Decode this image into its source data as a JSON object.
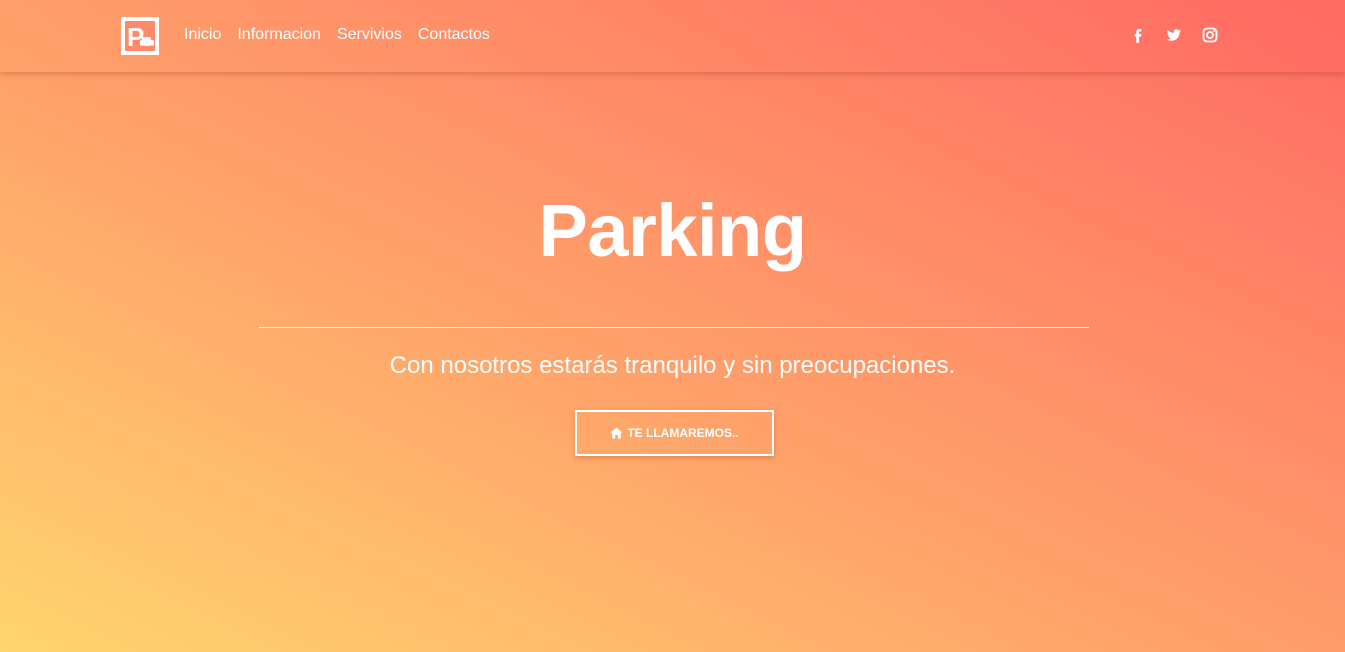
{
  "nav": {
    "logo_icon": "parking-car-icon",
    "links": [
      {
        "label": "Inicio"
      },
      {
        "label": "Informacion"
      },
      {
        "label": "Servivios"
      },
      {
        "label": "Contactos"
      }
    ],
    "social": [
      "facebook-icon",
      "twitter-icon",
      "instagram-icon"
    ]
  },
  "hero": {
    "title": "Parking",
    "subtitle": "Con nosotros estarás tranquilo y sin preocupaciones.",
    "cta_label": "TE LLAMAREMOS..",
    "cta_icon": "home-icon"
  },
  "colors": {
    "gradient_start": "#ffd56e",
    "gradient_mid": "#ffa16a",
    "gradient_end": "#ff6b63",
    "logo_red": "#ff7a6b",
    "text": "#ffffff"
  }
}
